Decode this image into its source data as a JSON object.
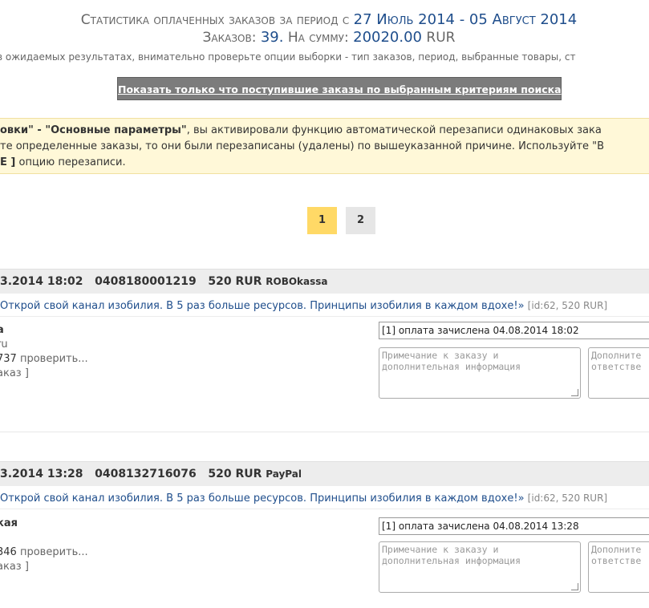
{
  "header": {
    "line1_prefix": "Статистика оплаченных заказов за период с",
    "line1_period": "27 Июль 2014 - 05 Август 2014",
    "line2_orders_label": "Заказов:",
    "line2_orders_count": "39.",
    "line2_sum_label": "На сумму:",
    "line2_sum_value": "20020.00",
    "line2_currency": "RUR",
    "hint": "в ожидаемых результатах, внимательно проверьте опции выборки - тип заказов, период, выбранные товары, ст"
  },
  "show_new_button": "Показать только что поступившие заказы по выбранным критериям поиска",
  "warning": {
    "line1_a": "овки\" - ",
    "line1_b": "\"Основные параметры\"",
    "line1_c": ", вы активировали функцию автоматической перезаписи одинаковых зака",
    "line2": "те определенные заказы, то они были перезаписаны (удалены) по вышеуказанной причине. Используйте \"В",
    "line3_a": "E ]",
    "line3_b": " опцию перезаписи."
  },
  "pagination": {
    "page1": "1",
    "page2": "2"
  },
  "orders": [
    {
      "datetime": "3.2014 18:02",
      "order_id": "0408180001219",
      "amount": "520 RUR",
      "payment": "ROBOkassa",
      "product": "Открой свой канал изобилия. В 5 раз больше ресурсов. Принципы изобилия в каждом вдохе!»",
      "product_meta": "[id:62, 520 RUR]",
      "customer_name": "a",
      "customer_email": "ru",
      "customer_phone": "737",
      "check_link": "проверить...",
      "order_link": "аказ ]",
      "status": "[1] оплата зачислена 04.08.2014 18:02",
      "note_placeholder": "Примечание к заказу и дополнительная информация",
      "extra_placeholder": "Дополните ответстве"
    },
    {
      "datetime": "3.2014 13:28",
      "order_id": "0408132716076",
      "amount": "520 RUR",
      "payment": "PayPal",
      "product": "Открой свой канал изобилия. В 5 раз больше ресурсов. Принципы изобилия в каждом вдохе!»",
      "product_meta": "[id:62, 520 RUR]",
      "customer_name": "кая",
      "customer_email": "",
      "customer_phone": "346",
      "check_link": "проверить...",
      "order_link": "аказ ]",
      "status": "[1] оплата зачислена 04.08.2014 13:28",
      "note_placeholder": "Примечание к заказу и дополнительная информация",
      "extra_placeholder": "Дополните ответстве"
    }
  ]
}
